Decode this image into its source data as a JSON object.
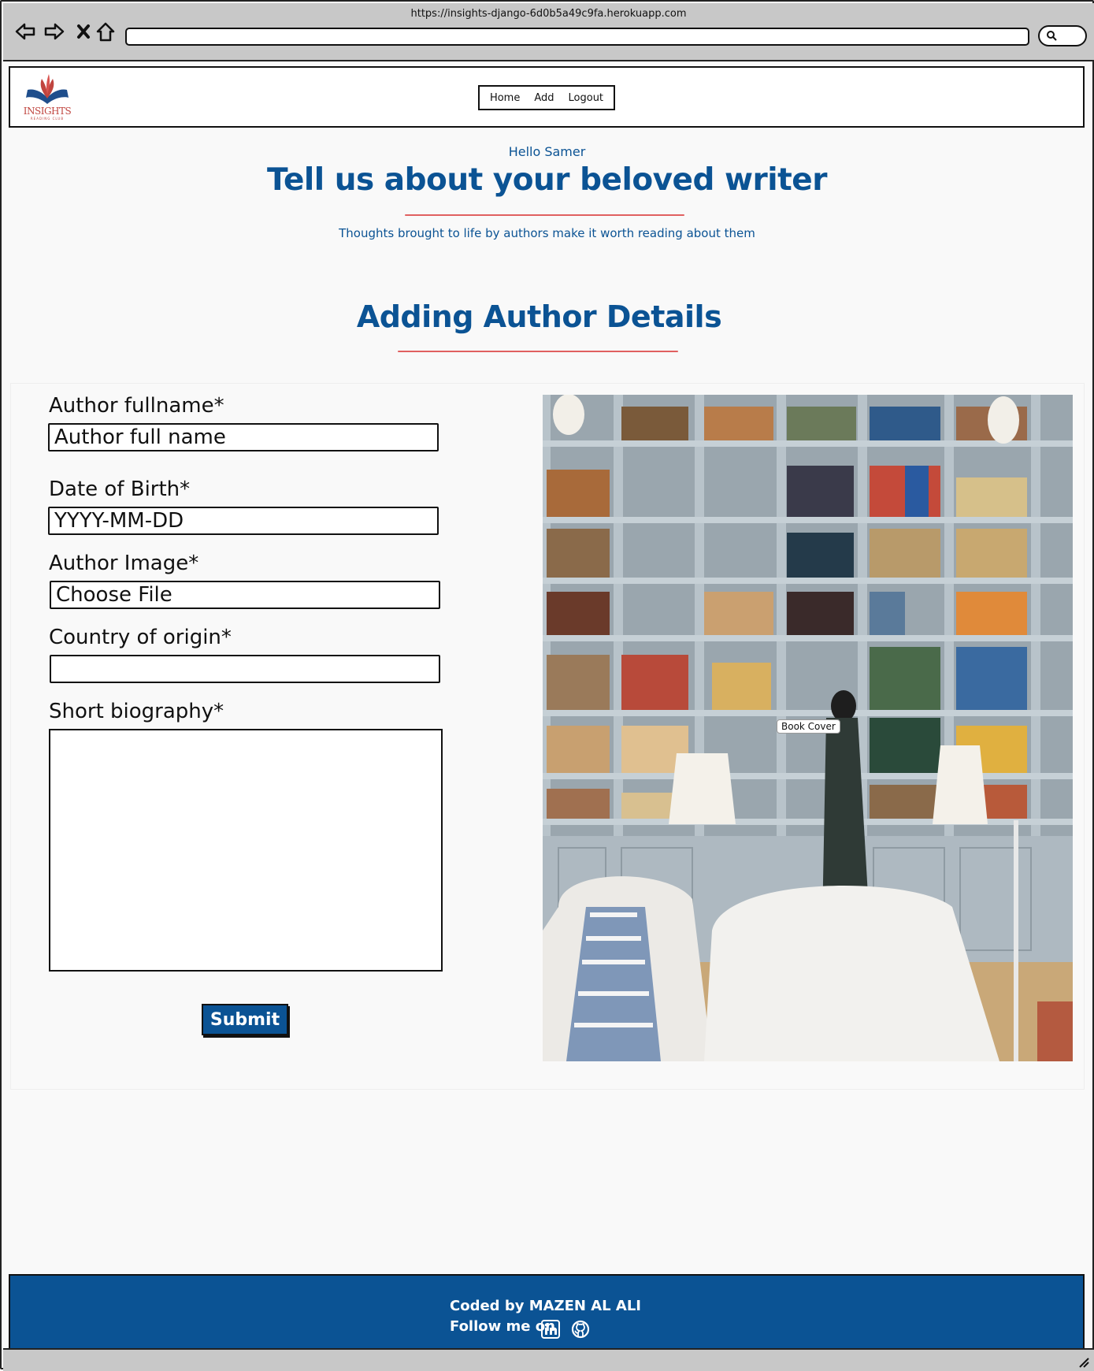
{
  "browser": {
    "url": "https://insights-django-6d0b5a49c9fa.herokuapp.com"
  },
  "header": {
    "logo_text": "INSIGHTS",
    "logo_subtext": "READING CLUB",
    "nav": [
      "Home",
      "Add",
      "Logout"
    ]
  },
  "hero": {
    "greeting": "Hello Samer",
    "title": "Tell us about your beloved writer",
    "subtitle": "Thoughts brought to life by authors make it worth reading about them"
  },
  "form": {
    "heading": "Adding Author Details",
    "fullname_label": "Author fullname*",
    "fullname_placeholder": "Author full name",
    "dob_label": "Date of Birth*",
    "dob_placeholder": "YYYY-MM-DD",
    "image_label": "Author Image*",
    "file_button": "Choose File",
    "country_label": "Country of origin*",
    "country_value": "",
    "bio_label": "Short biography*",
    "submit_label": "Submit"
  },
  "image": {
    "caption": "Book Cover"
  },
  "footer": {
    "credit": "Coded by MAZEN AL ALI",
    "follow": "Follow me on"
  },
  "colors": {
    "brand_blue": "#0b5394",
    "accent_red": "#e06060"
  }
}
